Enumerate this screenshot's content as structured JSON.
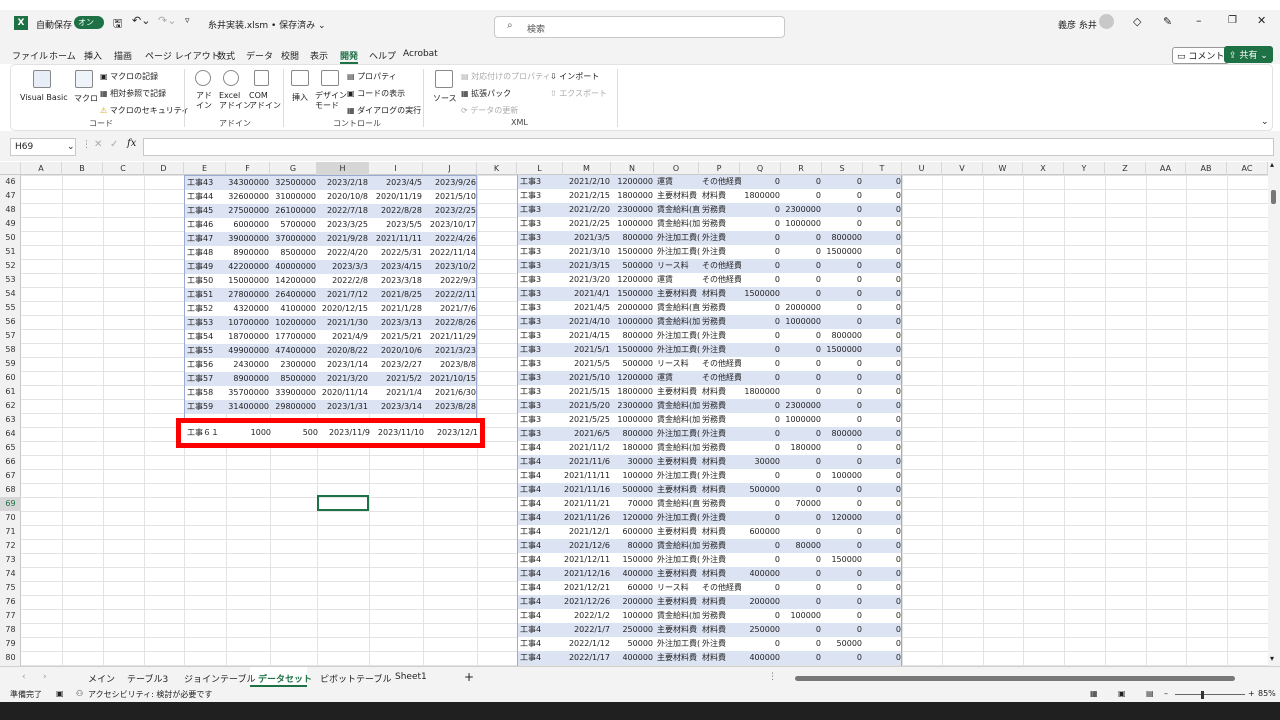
{
  "titlebar": {
    "autosave": "自動保存",
    "toggle": "オン",
    "filename": "糸井実装.xlsm • 保存済み ⌄",
    "search_placeholder": "検索",
    "user": "義彦 糸井"
  },
  "menu": [
    "ファイル",
    "ホーム",
    "挿入",
    "描画",
    "ページ レイアウト",
    "数式",
    "データ",
    "校閲",
    "表示",
    "開発",
    "ヘルプ",
    "Acrobat"
  ],
  "menu_active": "開発",
  "comment_btn": "コメント",
  "share_btn": "共有",
  "ribbon": {
    "vba": "Visual Basic",
    "macro": "マクロ",
    "record": "マクロの記録",
    "relative": "相対参照で記録",
    "security": "マクロのセキュリティ",
    "addin": "アド\nイン",
    "excel_addin": "Excel\nアドイン",
    "com_addin": "COM\nアドイン",
    "insert": "挿入",
    "design": "デザイン\nモード",
    "props": "プロパティ",
    "viewcode": "コードの表示",
    "dialog": "ダイアログの実行",
    "source": "ソース",
    "map_props": "対応付けのプロパティ",
    "expansion": "拡張パック",
    "refresh": "データの更新",
    "import": "インポート",
    "export": "エクスポート",
    "groups": {
      "code": "コード",
      "addin": "アドイン",
      "control": "コントロール",
      "xml": "XML"
    }
  },
  "namebox": "H69",
  "columns": [
    "A",
    "B",
    "C",
    "D",
    "E",
    "F",
    "G",
    "H",
    "I",
    "J",
    "K",
    "L",
    "M",
    "N",
    "O",
    "P",
    "Q",
    "R",
    "S",
    "T",
    "U",
    "V",
    "W",
    "X",
    "Y",
    "Z",
    "AA",
    "AB",
    "AC"
  ],
  "row_numbers": [
    "46",
    "47",
    "48",
    "49",
    "50",
    "51",
    "52",
    "53",
    "54",
    "55",
    "56",
    "57",
    "58",
    "59",
    "60",
    "61",
    "62",
    "63",
    "64",
    "65",
    "66",
    "67",
    "68",
    "69",
    "70",
    "71",
    "72",
    "73",
    "74",
    "75",
    "76",
    "77",
    "78",
    "79",
    "80"
  ],
  "table_e": [
    [
      "工事43",
      "34300000",
      "32500000",
      "2023/2/18",
      "2023/4/5",
      "2023/9/26"
    ],
    [
      "工事44",
      "32600000",
      "31000000",
      "2020/10/8",
      "2020/11/19",
      "2021/5/10"
    ],
    [
      "工事45",
      "27500000",
      "26100000",
      "2022/7/18",
      "2022/8/28",
      "2023/2/25"
    ],
    [
      "工事46",
      "6000000",
      "5700000",
      "2023/3/25",
      "2023/5/5",
      "2023/10/17"
    ],
    [
      "工事47",
      "39000000",
      "37000000",
      "2021/9/28",
      "2021/11/11",
      "2022/4/26"
    ],
    [
      "工事48",
      "8900000",
      "8500000",
      "2022/4/20",
      "2022/5/31",
      "2022/11/14"
    ],
    [
      "工事49",
      "42200000",
      "40000000",
      "2023/3/3",
      "2023/4/15",
      "2023/10/2"
    ],
    [
      "工事50",
      "15000000",
      "14200000",
      "2022/2/8",
      "2023/3/18",
      "2022/9/3"
    ],
    [
      "工事51",
      "27800000",
      "26400000",
      "2021/7/12",
      "2021/8/25",
      "2022/2/11"
    ],
    [
      "工事52",
      "4320000",
      "4100000",
      "2020/12/15",
      "2021/1/28",
      "2021/7/6"
    ],
    [
      "工事53",
      "10700000",
      "10200000",
      "2021/1/30",
      "2023/3/13",
      "2022/8/26"
    ],
    [
      "工事54",
      "18700000",
      "17700000",
      "2021/4/9",
      "2021/5/21",
      "2021/11/29"
    ],
    [
      "工事55",
      "49900000",
      "47400000",
      "2020/8/22",
      "2020/10/6",
      "2021/3/23"
    ],
    [
      "工事56",
      "2430000",
      "2300000",
      "2023/1/14",
      "2023/2/27",
      "2023/8/8"
    ],
    [
      "工事57",
      "8900000",
      "8500000",
      "2021/3/20",
      "2021/5/2",
      "2021/10/15"
    ],
    [
      "工事58",
      "35700000",
      "33900000",
      "2020/11/14",
      "2021/1/4",
      "2021/6/30"
    ],
    [
      "工事59",
      "31400000",
      "29800000",
      "2023/1/31",
      "2023/3/14",
      "2023/8/28"
    ]
  ],
  "red_row": [
    "工事６１",
    "1000",
    "500",
    "2023/11/9",
    "2023/11/10",
    "2023/12/1"
  ],
  "table_l": [
    [
      "工事3",
      "2021/2/10",
      "1200000",
      "運賃",
      "その他経費",
      "0",
      "0",
      "0",
      "0"
    ],
    [
      "工事3",
      "2021/2/15",
      "1800000",
      "主要材料費",
      "材料費",
      "1800000",
      "0",
      "0",
      "0"
    ],
    [
      "工事3",
      "2021/2/20",
      "2300000",
      "賃金給料(直",
      "労務費",
      "0",
      "2300000",
      "0",
      "0"
    ],
    [
      "工事3",
      "2021/2/25",
      "1000000",
      "賃金給料(加",
      "労務費",
      "0",
      "1000000",
      "0",
      "0"
    ],
    [
      "工事3",
      "2021/3/5",
      "800000",
      "外注加工費(1",
      "外注費",
      "0",
      "0",
      "800000",
      "0"
    ],
    [
      "工事3",
      "2021/3/10",
      "1500000",
      "外注加工費(1",
      "外注費",
      "0",
      "0",
      "1500000",
      "0"
    ],
    [
      "工事3",
      "2021/3/15",
      "500000",
      "リース料",
      "その他経費",
      "0",
      "0",
      "0",
      "0"
    ],
    [
      "工事3",
      "2021/3/20",
      "1200000",
      "運賃",
      "その他経費",
      "0",
      "0",
      "0",
      "0"
    ],
    [
      "工事3",
      "2021/4/1",
      "1500000",
      "主要材料費",
      "材料費",
      "1500000",
      "0",
      "0",
      "0"
    ],
    [
      "工事3",
      "2021/4/5",
      "2000000",
      "賃金給料(直",
      "労務費",
      "0",
      "2000000",
      "0",
      "0"
    ],
    [
      "工事3",
      "2021/4/10",
      "1000000",
      "賃金給料(加",
      "労務費",
      "0",
      "1000000",
      "0",
      "0"
    ],
    [
      "工事3",
      "2021/4/15",
      "800000",
      "外注加工費(1",
      "外注費",
      "0",
      "0",
      "800000",
      "0"
    ],
    [
      "工事3",
      "2021/5/1",
      "1500000",
      "外注加工費(1",
      "外注費",
      "0",
      "0",
      "1500000",
      "0"
    ],
    [
      "工事3",
      "2021/5/5",
      "500000",
      "リース料",
      "その他経費",
      "0",
      "0",
      "0",
      "0"
    ],
    [
      "工事3",
      "2021/5/10",
      "1200000",
      "運賃",
      "その他経費",
      "0",
      "0",
      "0",
      "0"
    ],
    [
      "工事3",
      "2021/5/15",
      "1800000",
      "主要材料費",
      "材料費",
      "1800000",
      "0",
      "0",
      "0"
    ],
    [
      "工事3",
      "2021/5/20",
      "2300000",
      "賃金給料(加",
      "労務費",
      "0",
      "2300000",
      "0",
      "0"
    ],
    [
      "工事3",
      "2021/5/25",
      "1000000",
      "賃金給料(加",
      "労務費",
      "0",
      "1000000",
      "0",
      "0"
    ],
    [
      "工事3",
      "2021/6/5",
      "800000",
      "外注加工費(1",
      "外注費",
      "0",
      "0",
      "800000",
      "0"
    ],
    [
      "工事4",
      "2021/11/2",
      "180000",
      "賃金給料(加",
      "労務費",
      "0",
      "180000",
      "0",
      "0"
    ],
    [
      "工事4",
      "2021/11/6",
      "30000",
      "主要材料費",
      "材料費",
      "30000",
      "0",
      "0",
      "0"
    ],
    [
      "工事4",
      "2021/11/11",
      "100000",
      "外注加工費(1",
      "外注費",
      "0",
      "0",
      "100000",
      "0"
    ],
    [
      "工事4",
      "2021/11/16",
      "500000",
      "主要材料費",
      "材料費",
      "500000",
      "0",
      "0",
      "0"
    ],
    [
      "工事4",
      "2021/11/21",
      "70000",
      "賃金給料(直",
      "労務費",
      "0",
      "70000",
      "0",
      "0"
    ],
    [
      "工事4",
      "2021/11/26",
      "120000",
      "外注加工費(1",
      "外注費",
      "0",
      "0",
      "120000",
      "0"
    ],
    [
      "工事4",
      "2021/12/1",
      "600000",
      "主要材料費",
      "材料費",
      "600000",
      "0",
      "0",
      "0"
    ],
    [
      "工事4",
      "2021/12/6",
      "80000",
      "賃金給料(加",
      "労務費",
      "0",
      "80000",
      "0",
      "0"
    ],
    [
      "工事4",
      "2021/12/11",
      "150000",
      "外注加工費(1",
      "外注費",
      "0",
      "0",
      "150000",
      "0"
    ],
    [
      "工事4",
      "2021/12/16",
      "400000",
      "主要材料費",
      "材料費",
      "400000",
      "0",
      "0",
      "0"
    ],
    [
      "工事4",
      "2021/12/21",
      "60000",
      "リース料",
      "その他経費",
      "0",
      "0",
      "0",
      "0"
    ],
    [
      "工事4",
      "2021/12/26",
      "200000",
      "主要材料費",
      "材料費",
      "200000",
      "0",
      "0",
      "0"
    ],
    [
      "工事4",
      "2022/1/2",
      "100000",
      "賃金給料(加",
      "労務費",
      "0",
      "100000",
      "0",
      "0"
    ],
    [
      "工事4",
      "2022/1/7",
      "250000",
      "主要材料費",
      "材料費",
      "250000",
      "0",
      "0",
      "0"
    ],
    [
      "工事4",
      "2022/1/12",
      "50000",
      "外注加工費(1",
      "外注費",
      "0",
      "0",
      "50000",
      "0"
    ],
    [
      "工事4",
      "2022/1/17",
      "400000",
      "主要材料費",
      "材料費",
      "400000",
      "0",
      "0",
      "0"
    ]
  ],
  "sheets": [
    "メイン",
    "テーブル3",
    "ジョインテーブル",
    "データセット",
    "ピボットテーブル",
    "Sheet1"
  ],
  "active_sheet": "データセット",
  "status": {
    "ready": "準備完了",
    "accessibility": "アクセシビリティ: 検討が必要です",
    "zoom": "85%"
  }
}
